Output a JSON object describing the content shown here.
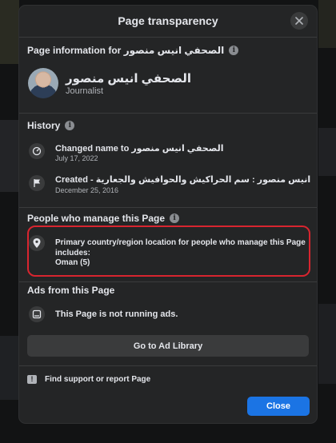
{
  "dialog": {
    "title": "Page transparency",
    "close_icon": "close-icon"
  },
  "page_info": {
    "title": "Page information for الصحفي انيس منصور",
    "name": "الصحفي انيس منصور",
    "role": "Journalist"
  },
  "history": {
    "title": "History",
    "items": [
      {
        "icon": "rename-clock-icon",
        "main": "Changed name to الصحفي انيس منصور",
        "date": "July 17, 2022"
      },
      {
        "icon": "flag-icon",
        "main": "Created - انيس منصور : سم الحراكيش والحوافيش والجعارية",
        "date": "December 25, 2016"
      }
    ]
  },
  "managers": {
    "title": "People who manage this Page",
    "description": "Primary country/region location for people who manage this Page includes:",
    "value": "Oman (5)",
    "icon": "location-pin-icon"
  },
  "ads": {
    "title": "Ads from this Page",
    "status": "This Page is not running ads.",
    "icon": "ads-icon",
    "button_label": "Go to Ad Library"
  },
  "support": {
    "label": "Find support or report Page",
    "icon": "report-icon"
  },
  "footer": {
    "close_label": "Close"
  },
  "colors": {
    "dialog_bg": "#242526",
    "highlight": "#d8252f",
    "primary_button": "#1b74e4"
  }
}
